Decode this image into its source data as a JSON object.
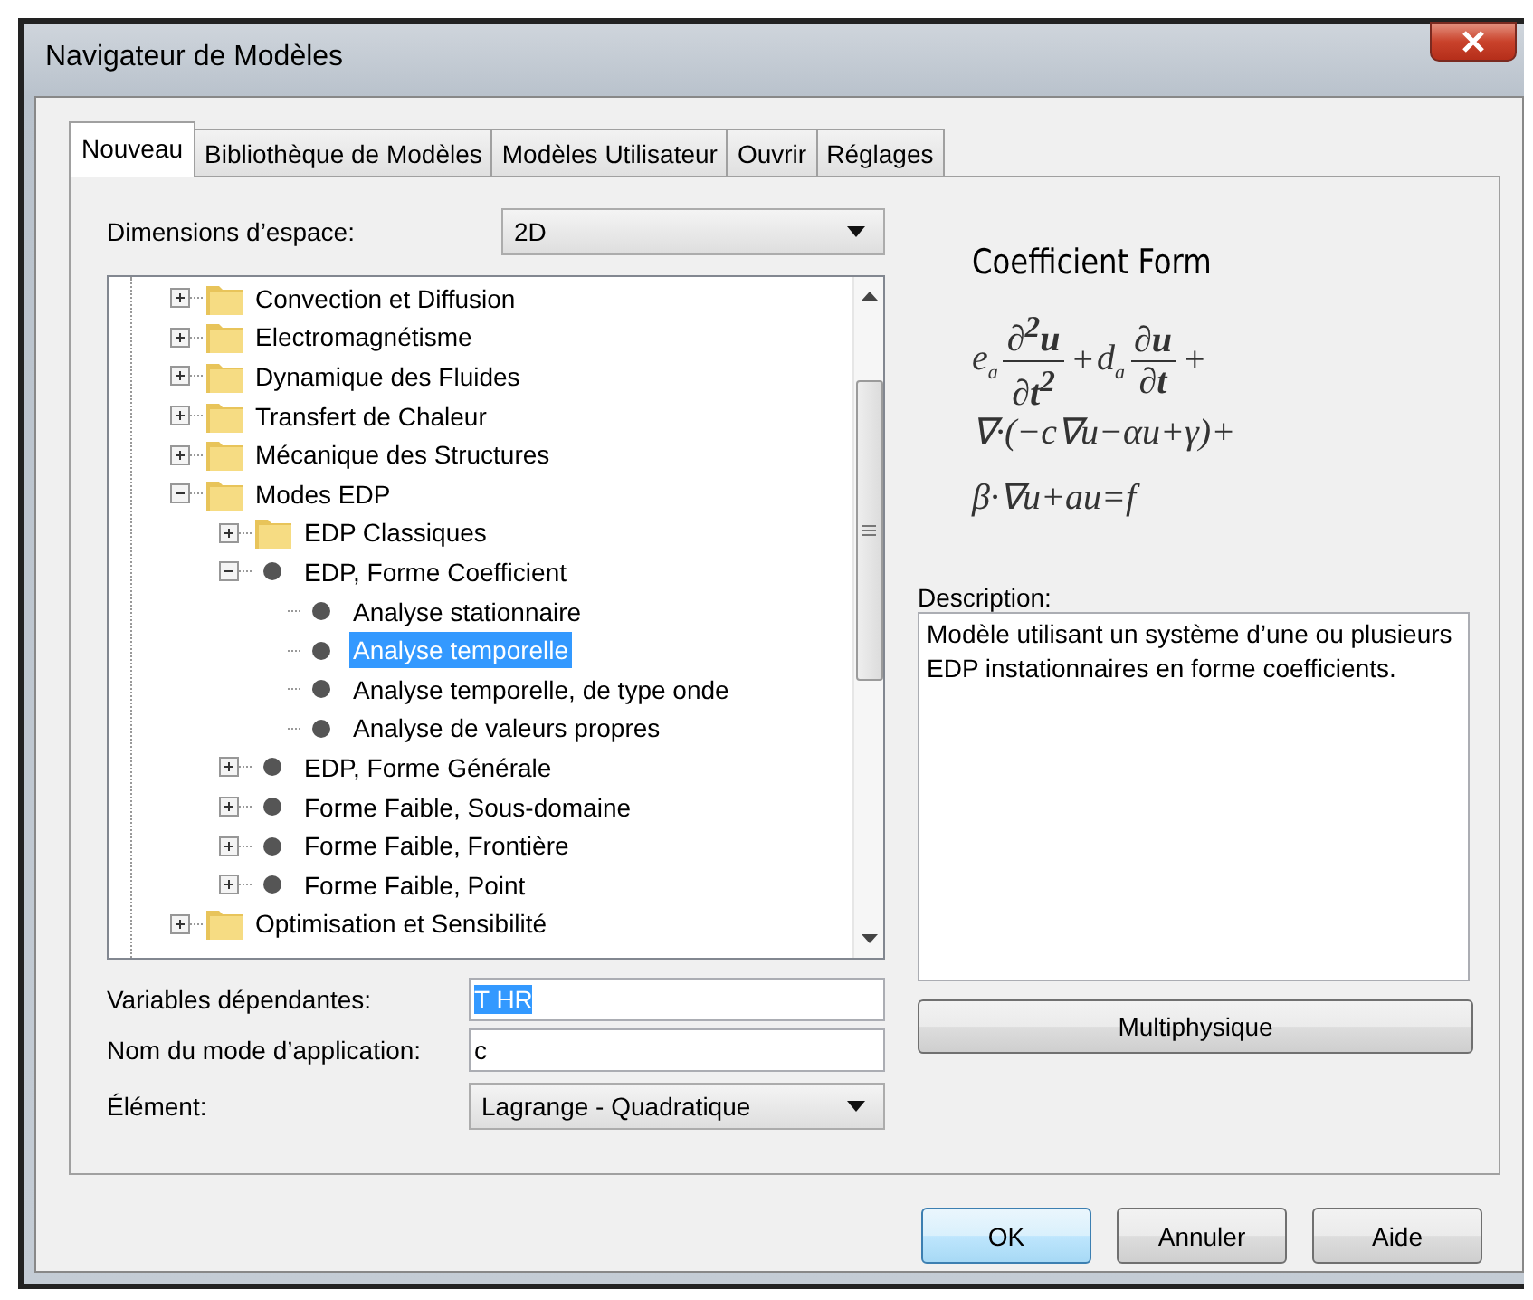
{
  "window": {
    "title": "Navigateur de Modèles"
  },
  "tabs": [
    {
      "label": "Nouveau",
      "selected": true
    },
    {
      "label": "Bibliothèque de Modèles",
      "selected": false
    },
    {
      "label": "Modèles Utilisateur",
      "selected": false
    },
    {
      "label": "Ouvrir",
      "selected": false
    },
    {
      "label": "Réglages",
      "selected": false
    }
  ],
  "space_dimension": {
    "label": "Dimensions d’espace:",
    "value": "2D"
  },
  "tree": {
    "items": [
      {
        "label": "Convection et Diffusion",
        "kind": "folder",
        "expanded": false,
        "selected": false
      },
      {
        "label": "Electromagnétisme",
        "kind": "folder",
        "expanded": false,
        "selected": false
      },
      {
        "label": "Dynamique des Fluides",
        "kind": "folder",
        "expanded": false,
        "selected": false
      },
      {
        "label": "Transfert de Chaleur",
        "kind": "folder",
        "expanded": false,
        "selected": false
      },
      {
        "label": "Mécanique des Structures",
        "kind": "folder",
        "expanded": false,
        "selected": false
      },
      {
        "label": "Modes EDP",
        "kind": "folder",
        "expanded": true,
        "selected": false,
        "children": [
          {
            "label": "EDP Classiques",
            "kind": "folder",
            "expanded": false,
            "selected": false
          },
          {
            "label": "EDP, Forme Coefficient",
            "kind": "mode",
            "expanded": true,
            "selected": false,
            "children": [
              {
                "label": "Analyse stationnaire",
                "kind": "mode",
                "selected": false
              },
              {
                "label": "Analyse temporelle",
                "kind": "mode",
                "selected": true
              },
              {
                "label": "Analyse temporelle, de type onde",
                "kind": "mode",
                "selected": false
              },
              {
                "label": "Analyse de valeurs propres",
                "kind": "mode",
                "selected": false
              }
            ]
          },
          {
            "label": "EDP, Forme Générale",
            "kind": "mode",
            "expanded": false,
            "selected": false
          },
          {
            "label": "Forme Faible, Sous-domaine",
            "kind": "mode",
            "expanded": false,
            "selected": false
          },
          {
            "label": "Forme Faible, Frontière",
            "kind": "mode",
            "expanded": false,
            "selected": false
          },
          {
            "label": "Forme Faible, Point",
            "kind": "mode",
            "expanded": false,
            "selected": false
          }
        ]
      },
      {
        "label": "Optimisation et Sensibilité",
        "kind": "folder",
        "expanded": false,
        "selected": false
      }
    ]
  },
  "preview": {
    "title": "Coefficient Form",
    "equation_first_line": [
      {
        "kind": "coef",
        "text": "e",
        "sub": "a"
      },
      {
        "kind": "frac",
        "num": "∂$^{2}$u",
        "den": "∂t$^{2}$"
      },
      {
        "kind": "op",
        "text": "+"
      },
      {
        "kind": "coef",
        "text": "d",
        "sub": "a"
      },
      {
        "kind": "frac",
        "num": "∂u",
        "den": "∂t"
      },
      {
        "kind": "op",
        "text": "+"
      }
    ],
    "equation_lines": [
      "∇·(−c∇u−αu+γ)+",
      "β·∇u+au=f"
    ]
  },
  "description": {
    "label": "Description:",
    "text": "Modèle utilisant un système d’une ou plusieurs EDP instationnaires en forme coefficients."
  },
  "fields": [
    {
      "label": "Variables dépendantes:",
      "kind": "text",
      "value": "T HR",
      "selected_text": true
    },
    {
      "label": "Nom du mode d’application:",
      "kind": "text",
      "value": "c",
      "selected_text": false
    },
    {
      "label": "Élément:",
      "kind": "dropdown",
      "value": "Lagrange - Quadratique"
    }
  ],
  "multiphysics_button": "Multiphysique",
  "buttons": [
    {
      "label": "OK",
      "default": true
    },
    {
      "label": "Annuler",
      "default": false
    },
    {
      "label": "Aide",
      "default": false
    }
  ]
}
